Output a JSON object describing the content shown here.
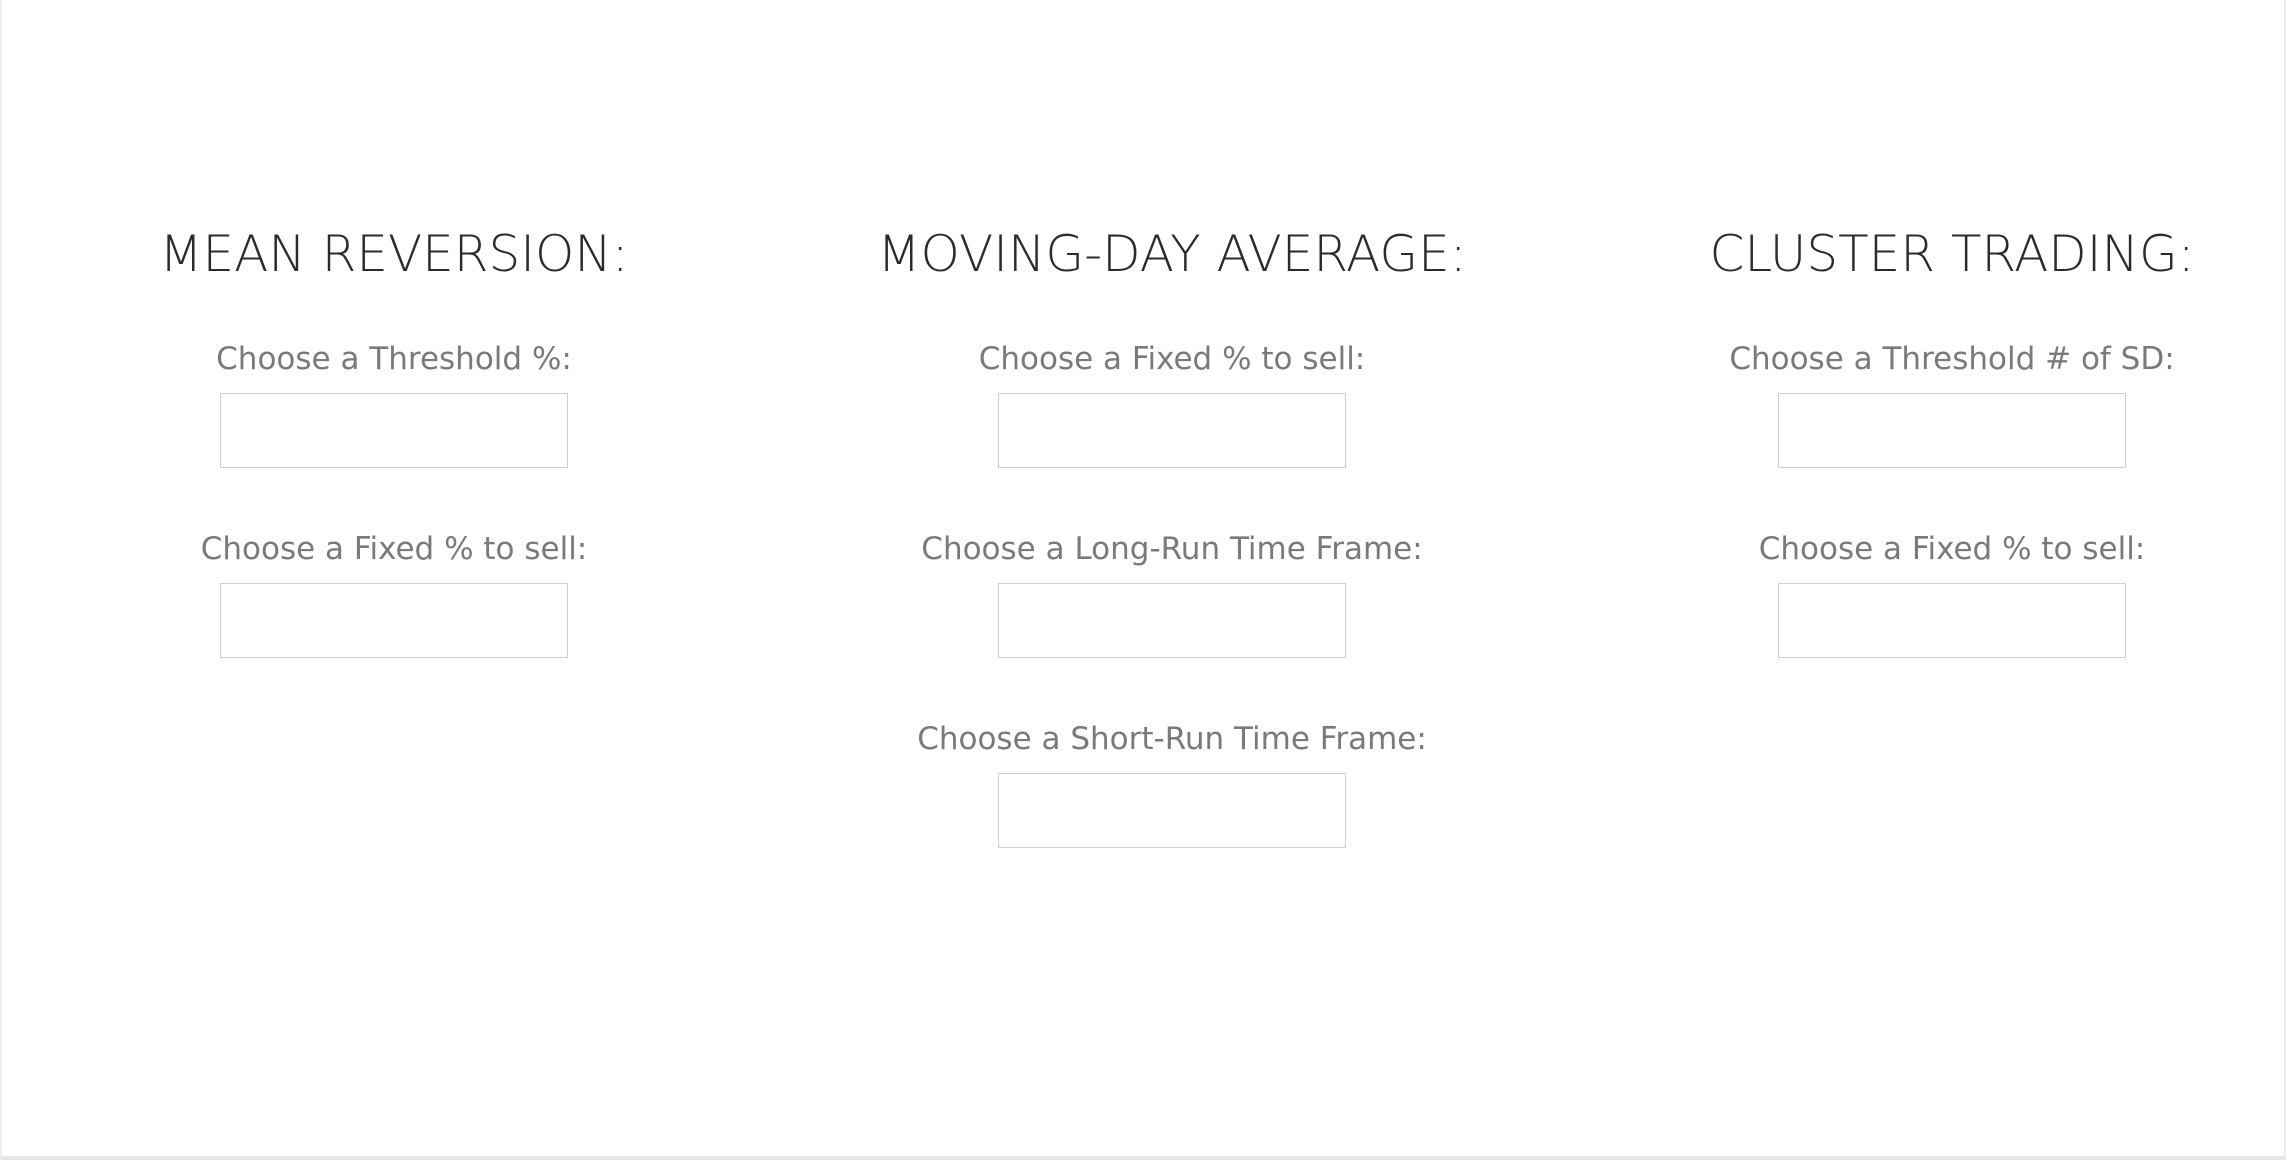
{
  "sections": [
    {
      "title": "MEAN REVERSION:",
      "fields": [
        {
          "label": "Choose a Threshold %:",
          "value": ""
        },
        {
          "label": "Choose a Fixed % to sell:",
          "value": ""
        }
      ]
    },
    {
      "title": "MOVING-DAY AVERAGE:",
      "fields": [
        {
          "label": "Choose a Fixed % to sell:",
          "value": ""
        },
        {
          "label": "Choose a Long-Run Time Frame:",
          "value": ""
        },
        {
          "label": "Choose a Short-Run Time Frame:",
          "value": ""
        }
      ]
    },
    {
      "title": "CLUSTER TRADING:",
      "fields": [
        {
          "label": "Choose a Threshold # of SD:",
          "value": ""
        },
        {
          "label": "Choose a Fixed % to sell:",
          "value": ""
        }
      ]
    }
  ]
}
